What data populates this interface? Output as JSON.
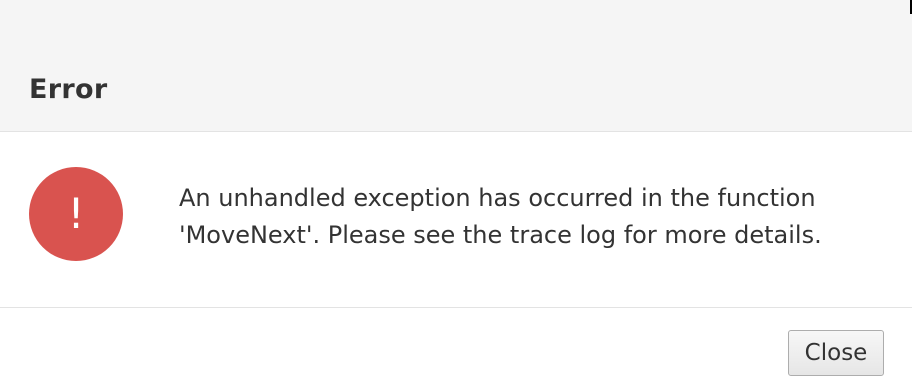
{
  "dialog": {
    "title": "Error",
    "icon": {
      "name": "exclamation-icon",
      "glyph": "!",
      "color": "#d9534f"
    },
    "message": "An unhandled exception has occurred in the function 'MoveNext'. Please see the trace log for more details.",
    "close_label": "Close"
  }
}
